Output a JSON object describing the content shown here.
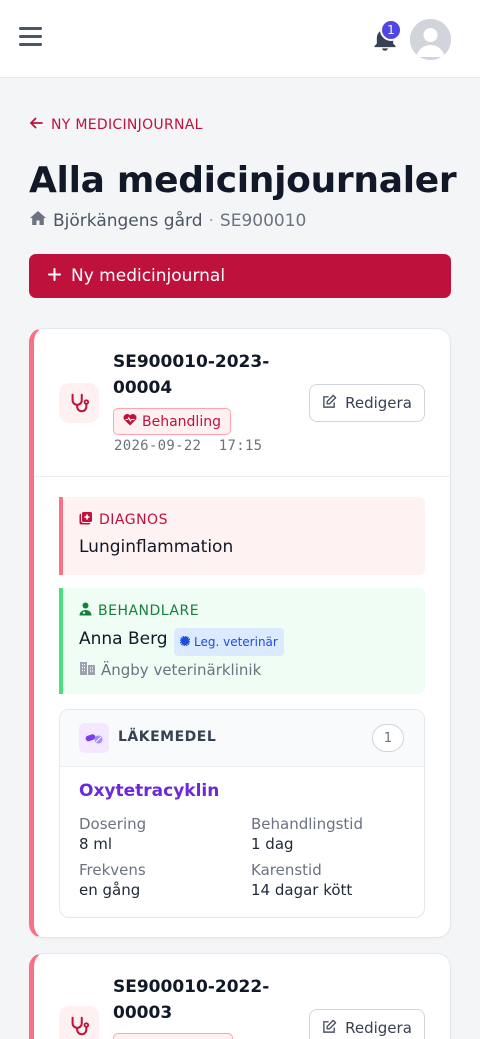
{
  "header": {
    "notification_count": "1"
  },
  "nav": {
    "back_label": "NY MEDICINJOURNAL"
  },
  "page": {
    "title": "Alla medicinjournaler",
    "farm_name": "Björkängens gård",
    "separator": "·",
    "farm_id": "SE900010",
    "new_button_label": "Ny medicinjournal"
  },
  "records": [
    {
      "number_line1": "SE900010-2023-",
      "number_line2": "00004",
      "type": "Behandling",
      "timestamp": "2026-09-22  17:15",
      "edit_label": "Redigera",
      "diagnosis_label": "DIAGNOS",
      "diagnosis": "Lunginflammation",
      "vet_label": "BEHANDLARE",
      "vet_name": "Anna Berg",
      "vet_role": "Leg. veterinär",
      "vet_clinic": "Ängby veterinärklinik",
      "meds_label": "LÄKEMEDEL",
      "meds_count": "1",
      "medications": [
        {
          "name": "Oxytetracyklin",
          "dosage_label": "Dosering",
          "dosage": "8 ml",
          "duration_label": "Behandlingstid",
          "duration": "1 dag",
          "frequency_label": "Frekvens",
          "frequency": "en gång",
          "withdrawal_label": "Karenstid",
          "withdrawal": "14 dagar kött"
        }
      ]
    },
    {
      "number_line1": "SE900010-2022-",
      "number_line2": "00003",
      "edit_label": "Redigera"
    }
  ],
  "colors": {
    "primary": "#be123c",
    "accent_left": "#f87187",
    "diagnosis_bg": "#fef2f2",
    "vet_accent": "#4ade80",
    "drug_name": "#6d28d9",
    "badge_blue": "#4f46e5"
  }
}
